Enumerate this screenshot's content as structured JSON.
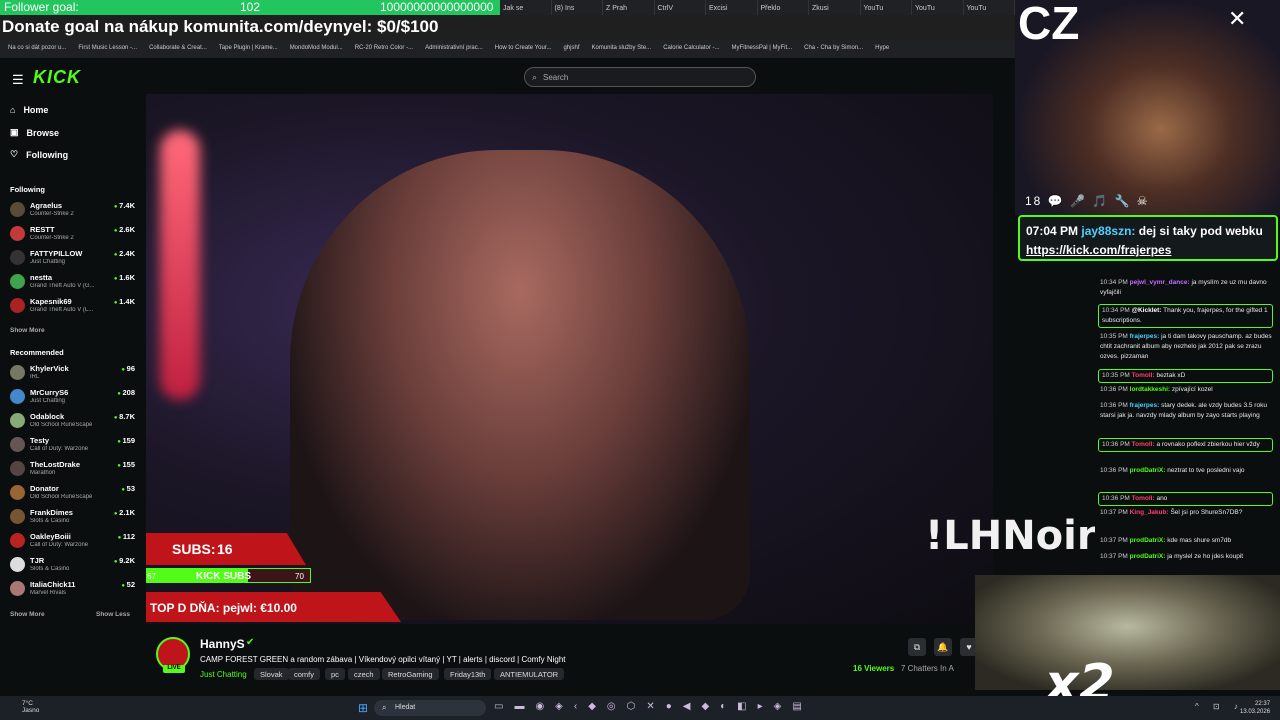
{
  "overlay": {
    "follower_goal_label": "Follower goal:",
    "follower_count": "102",
    "follower_target": "10000000000000000",
    "donate_text": "Donate goal na nákup komunita.com/deynyel: $0/$100"
  },
  "browser": {
    "tabs": [
      "Jak se",
      "(8) Ins",
      "Z Prah",
      "CtrlV",
      "Excisi",
      "Překlo",
      "Zkusi",
      "YouTu",
      "YouTu",
      "YouTu"
    ],
    "bookmarks": [
      "Na co si dát pozor u...",
      "First Music Lesson -...",
      "Collaborate & Creat...",
      "Tape Plugin | Krame...",
      "MondoMod Modul...",
      "RC-20 Retro Color -...",
      "Administrativní prac...",
      "How to Create Your...",
      "ghjshf",
      "Komunita služby Ste...",
      "Calorie Calculator -...",
      "MyFitnessPal | MyFit...",
      "Cha - Cha by Simon...",
      "Hype"
    ]
  },
  "kick": {
    "logo": "KICK",
    "search_placeholder": "Search",
    "nav": {
      "home": "Home",
      "browse": "Browse",
      "following": "Following"
    },
    "following_title": "Following",
    "following": [
      {
        "name": "Agraelus",
        "game": "Counter-Strike 2",
        "viewers": "7.4K"
      },
      {
        "name": "RESTT",
        "game": "Counter-Strike 2",
        "viewers": "2.6K"
      },
      {
        "name": "FATTYPILLOW",
        "game": "Just Chatting",
        "viewers": "2.4K"
      },
      {
        "name": "nestta",
        "game": "Grand Theft Auto V (G...",
        "viewers": "1.6K"
      },
      {
        "name": "Kapesnik69",
        "game": "Grand Theft Auto V (L...",
        "viewers": "1.4K"
      }
    ],
    "show_more": "Show More",
    "recommended_title": "Recommended",
    "recommended": [
      {
        "name": "KhylerVick",
        "game": "IRL",
        "viewers": "96"
      },
      {
        "name": "MrCurryS6",
        "game": "Just Chatting",
        "viewers": "208"
      },
      {
        "name": "Odablock",
        "game": "Old School RuneScape",
        "viewers": "8.7K"
      },
      {
        "name": "Testy",
        "game": "Call of Duty: Warzone",
        "viewers": "159"
      },
      {
        "name": "TheLostDrake",
        "game": "Marathon",
        "viewers": "155"
      },
      {
        "name": "Donator",
        "game": "Old School RuneScape",
        "viewers": "53"
      },
      {
        "name": "FrankDimes",
        "game": "Slots & Casino",
        "viewers": "2.1K"
      },
      {
        "name": "OakleyBoiii",
        "game": "Call of Duty: Warzone",
        "viewers": "112"
      },
      {
        "name": "TJR",
        "game": "Slots & Casino",
        "viewers": "9.2K"
      },
      {
        "name": "ItaliaChick11",
        "game": "Marvel Rivals",
        "viewers": "52"
      }
    ],
    "show_less": "Show Less"
  },
  "stream_overlay": {
    "brand": "!LHNoire",
    "subs_label": "SUBS:",
    "subs_value": "16",
    "kick_subs_label": "KICK SUBS",
    "kick_subs_min": "67",
    "kick_subs_max": "70",
    "kick_subs_progress": 0.62,
    "top_donation": "TOP D DŇA: pejwl: €10.00"
  },
  "stream_info": {
    "live_badge": "LIVE",
    "streamer": "HannyS",
    "title": "CAMP FOREST GREEN a random zábava | Víkendový opilci vítaný | YT | alerts | discord | Comfy Night",
    "category": "Just Chatting",
    "tags": [
      "Slovak",
      "comfy",
      "pc",
      "czech",
      "RetroGaming",
      "Friday13th",
      "ANTIEMULATOR"
    ],
    "viewers": "16 Viewers",
    "chatters": "7 Chatters In A"
  },
  "webcam": {
    "label": "CZ",
    "badges": "18 💬 🎤 🎵 🔧 ☠",
    "pinned_time": "07:04 PM",
    "pinned_user": "jay88szn:",
    "pinned_text": "dej si taky pod webku",
    "pinned_link": "https://kick.com/frajerpes"
  },
  "chat": [
    {
      "time": "10:34 PM",
      "user": "pejwl_vymr_dance:",
      "color": "#c46cff",
      "text": "ja myslím ze uz mu davno vyfajčili"
    },
    {
      "time": "10:34 PM",
      "user": "@Kicklet:",
      "color": "#ffffff",
      "text": "Thank you, frajerpes, for the gifted 1 subscriptions.",
      "hl": true
    },
    {
      "time": "10:35 PM",
      "user": "frajerpes:",
      "color": "#4fd0ff",
      "text": "ja ti dam takovy pauschamp. az budes chtit zachranit album aby nezhelo jak 2012 pak se zrazu ozves. pizzaman"
    },
    {
      "time": "10:35 PM",
      "user": "Tomoll:",
      "color": "#ff3f6c",
      "text": "beztak xD",
      "hl": true
    },
    {
      "time": "10:36 PM",
      "user": "lordtakkeshi:",
      "color": "#53fc18",
      "text": "zpívající kozel"
    },
    {
      "time": "10:36 PM",
      "user": "frajerpes:",
      "color": "#4fd0ff",
      "text": "stary dedek. ale vzdy budes 3.5 roku starsi jak ja. navzdy mlady album by zayo starts playing"
    },
    {
      "time": "10:36 PM",
      "user": "Tomoll:",
      "color": "#ff3f6c",
      "text": "a rovnako pofleхl zbierkou hier vždy",
      "hl": true
    },
    {
      "time": "10:36 PM",
      "user": "prodDatriX:",
      "color": "#53fc18",
      "text": "neztrat to tve posledni vajo"
    },
    {
      "time": "10:36 PM",
      "user": "Tomoll:",
      "color": "#ff3f6c",
      "text": "ano",
      "hl": true
    },
    {
      "time": "10:37 PM",
      "user": "King_Jakub:",
      "color": "#ff3f6c",
      "text": "Šel jsi pro ShureSn7DB?"
    },
    {
      "time": "10:37 PM",
      "user": "prodDatriX:",
      "color": "#53fc18",
      "text": "kde mas shure sm7db"
    },
    {
      "time": "10:37 PM",
      "user": "prodDatriX:",
      "color": "#53fc18",
      "text": "ja myslel ze ho jdes koupit"
    }
  ],
  "meme": {
    "text": "x2"
  },
  "taskbar": {
    "weather_temp": "7°C",
    "weather_desc": "Jasno",
    "search_placeholder": "Hledat",
    "time": "22:37",
    "date": "13.03.2026"
  }
}
